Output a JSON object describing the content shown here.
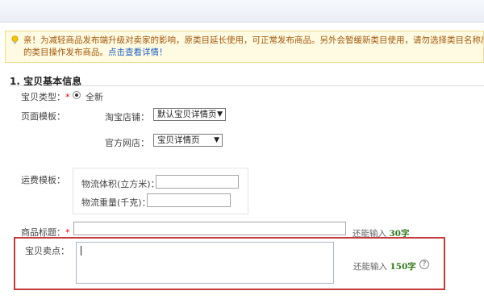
{
  "notice": {
    "line1": "亲！为减轻商品发布端升级对卖家的影响，原类目延长使用，可正常发布商品。另外会暂缓新类目使用，请勿选择类目名称后带（新",
    "line2_prefix": "的类目操作发布商品。",
    "link": "点击查看详情！"
  },
  "section": {
    "title": "1. 宝贝基本信息"
  },
  "form": {
    "item_type": {
      "label": "宝贝类型：",
      "required_mark": "*",
      "option": "全新"
    },
    "page_template": {
      "label": "页面模板：",
      "taobao_label": "淘宝店铺：",
      "taobao_value": "默认宝贝详情页",
      "official_label": "官方网店：",
      "official_value": "宝贝详情页"
    },
    "shipping": {
      "label": "运费模板：",
      "volume_label": "物流体积(立方米)：",
      "weight_label": "物流重量(千克)："
    },
    "title": {
      "label": "商品标题：",
      "required_mark": "*",
      "hint_prefix": "还能输入",
      "hint_count": "30字"
    },
    "selling_point": {
      "label": "宝贝卖点：",
      "hint_prefix": "还能输入",
      "hint_count": "150字",
      "help": "?"
    }
  },
  "icons": {
    "notice": "lightbulb-icon",
    "dropdown": "triangle-down-icon",
    "help": "question-circle-icon"
  },
  "colors": {
    "highlight": "#c43a3a",
    "count": "#2f7a1b",
    "notice_text": "#a2570c",
    "link": "#1f5fbf"
  }
}
